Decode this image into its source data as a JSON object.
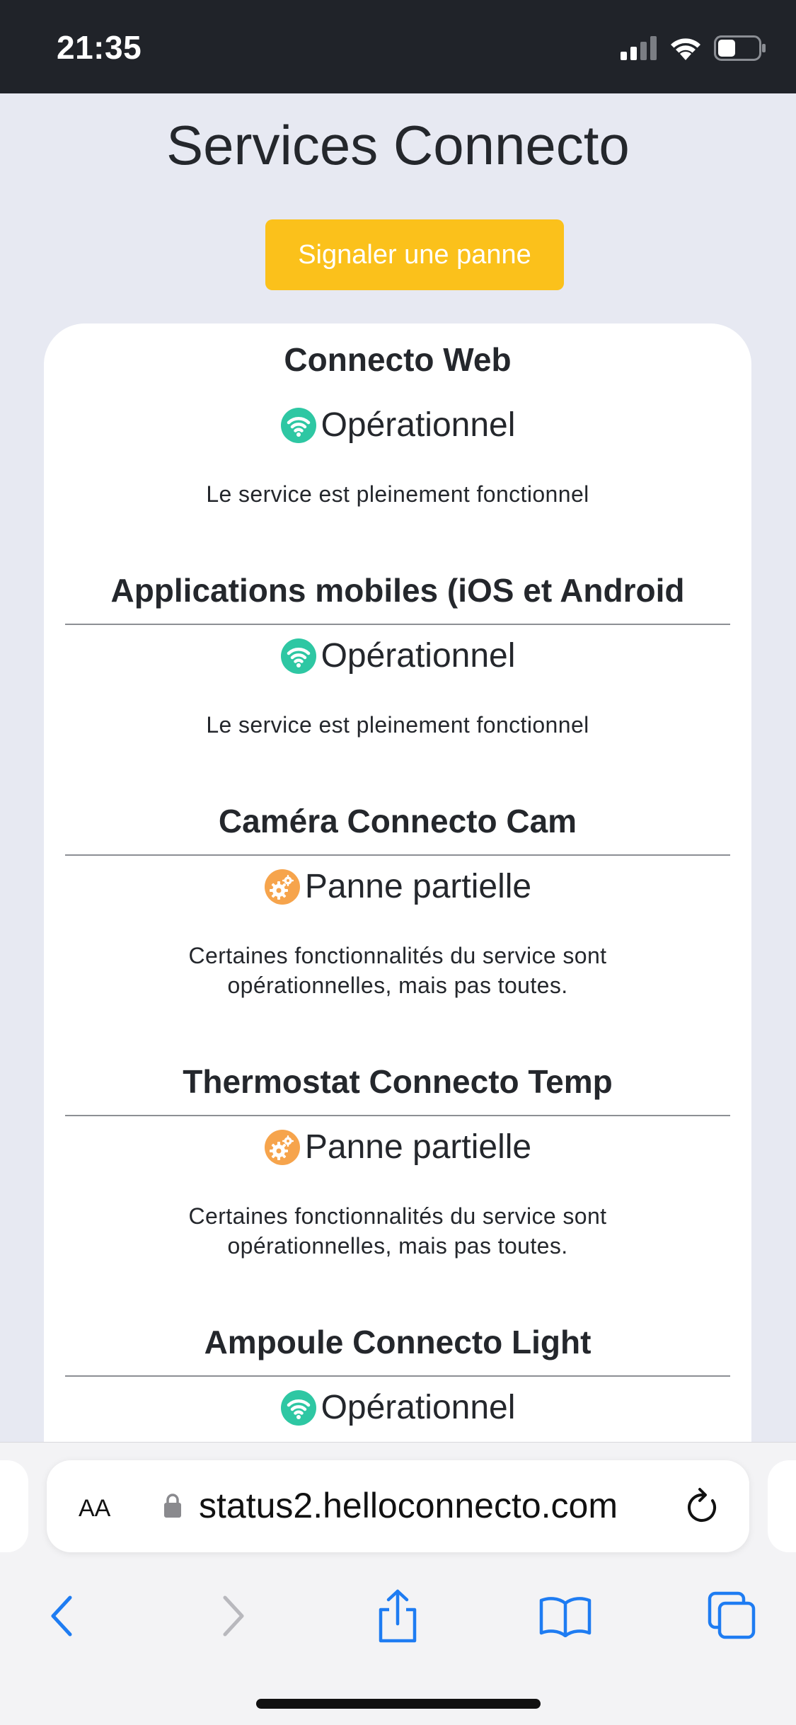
{
  "status_bar": {
    "time": "21:35"
  },
  "page": {
    "title": "Services Connecto",
    "report_button_label": "Signaler une panne"
  },
  "colors": {
    "accent_button": "#fbc11b",
    "operational": "#2ec7a3",
    "partial_outage": "#f6a44c"
  },
  "services": [
    {
      "name": "Connecto Web",
      "status": "Opérationnel",
      "status_icon": "wifi-icon",
      "description": "Le service est pleinement fonctionnel"
    },
    {
      "name": "Applications mobiles (iOS et Android",
      "status": "Opérationnel",
      "status_icon": "wifi-icon",
      "description": "Le service est pleinement fonctionnel"
    },
    {
      "name": "Caméra Connecto Cam",
      "status": "Panne partielle",
      "status_icon": "gears-icon",
      "description_line1": "Certaines fonctionnalités du service sont",
      "description_line2": "opérationnelles, mais pas toutes."
    },
    {
      "name": "Thermostat Connecto Temp",
      "status": "Panne partielle",
      "status_icon": "gears-icon",
      "description_line1": "Certaines fonctionnalités du service sont",
      "description_line2": "opérationnelles, mais pas toutes."
    },
    {
      "name": "Ampoule Connecto Light",
      "status": "Opérationnel",
      "status_icon": "wifi-icon"
    }
  ],
  "browser": {
    "text_size_button": "AA",
    "url": "status2.helloconnecto.com",
    "lock_icon": "lock-icon",
    "reload_icon": "reload-icon",
    "toolbar_icons": [
      "back-icon",
      "forward-icon",
      "share-icon",
      "bookmarks-icon",
      "tabs-icon"
    ]
  }
}
